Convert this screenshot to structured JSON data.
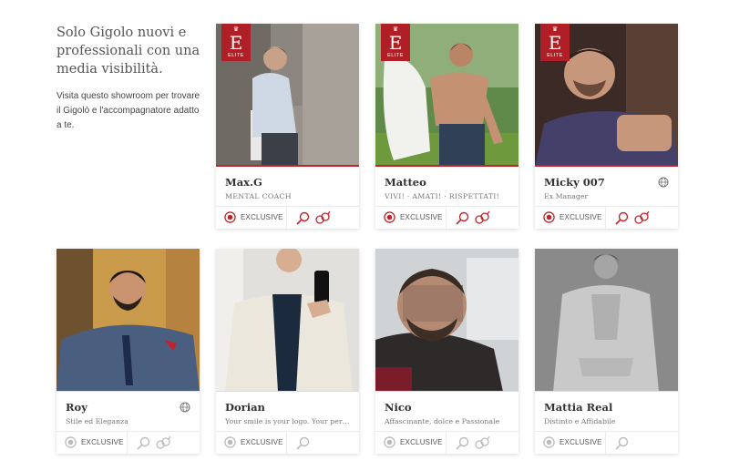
{
  "intro": {
    "title": "Solo Gigolo nuovi e professionali con una media visibilità.",
    "text": "Visita questo showroom per trovare il Gigolò e l'accompagnatore adatto a te."
  },
  "badge": {
    "letter": "E",
    "word": "ELITE"
  },
  "exclusive_label": "EXCLUSIVE",
  "colors": {
    "accent": "#c0242b",
    "muted": "#b7b7b7"
  },
  "profiles": [
    {
      "name": "Max.G",
      "tagline": "MENTAL COACH",
      "elite": true,
      "globe": false
    },
    {
      "name": "Matteo",
      "tagline": "VIVI! · AMATI! · RISPETTATI!",
      "elite": true,
      "globe": false
    },
    {
      "name": "Micky 007",
      "tagline": "Ex Manager",
      "elite": true,
      "globe": true
    },
    {
      "name": "Roy",
      "tagline": "Stile ed Eleganza",
      "elite": false,
      "globe": true
    },
    {
      "name": "Dorian",
      "tagline": "Your smile is your logo. Your person...",
      "elite": false,
      "globe": false
    },
    {
      "name": "Nico",
      "tagline": "Affascinante, dolce e Passionale",
      "elite": false,
      "globe": false
    },
    {
      "name": "Mattia Real",
      "tagline": "Distinto e Affidabile",
      "elite": false,
      "globe": false
    }
  ]
}
